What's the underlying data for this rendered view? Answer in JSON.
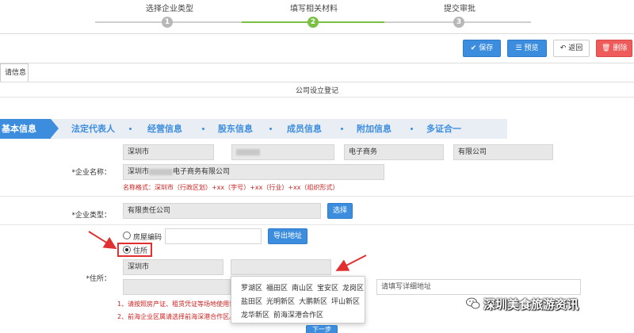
{
  "stepper": {
    "steps": [
      {
        "label": "选择企业类型",
        "num": "1"
      },
      {
        "label": "填写相关材料",
        "num": "2"
      },
      {
        "label": "提交审批",
        "num": "3"
      }
    ]
  },
  "toolbar": {
    "save": "保存",
    "preview": "预览",
    "back": "返回",
    "delete": "删除"
  },
  "tab": {
    "label": "请信息"
  },
  "form_title": "公司设立登记",
  "wizard": {
    "active": "基本信息",
    "items": [
      "法定代表人",
      "经营信息",
      "股东信息",
      "成员信息",
      "附加信息",
      "多证合一"
    ]
  },
  "company_name": {
    "label": "*企业名称：",
    "parts": [
      "深圳市",
      "",
      "电子商务",
      "有限公司"
    ],
    "full_prefix": "深圳市",
    "full_suffix": "电子商务有限公司",
    "hint": "名称格式：深圳市（行政区划）+xx（字号）+xx（行业）+xx（组织形式）"
  },
  "company_type": {
    "label": "*企业类型：",
    "value": "有限责任公司",
    "select_button": "选择"
  },
  "address": {
    "label": "*住所：",
    "option_house_code": "房屋编码",
    "option_residence": "住所",
    "export_button": "导出地址",
    "city": "深圳市",
    "detail_placeholder": "请填写详细地址",
    "notes": [
      "1、请按照房产证、租赁凭证等场地使用证明",
      "2、前海企业区属请选择前海深港合作区。"
    ]
  },
  "district_dropdown": {
    "rows": [
      [
        "罗湖区",
        "福田区",
        "南山区",
        "宝安区",
        "龙岗区"
      ],
      [
        "盐田区",
        "光明新区",
        "大鹏新区",
        "坪山新区"
      ],
      [
        "龙华新区",
        "前海深港合作区"
      ]
    ]
  },
  "next_button": "下一步",
  "watermark": {
    "text": "深圳美食旅游资讯",
    "icon": "wechat-icon"
  },
  "colors": {
    "accent": "#3c8dde",
    "progress": "#7ac143",
    "danger": "#ef5a5a",
    "hint": "#cc2222"
  }
}
